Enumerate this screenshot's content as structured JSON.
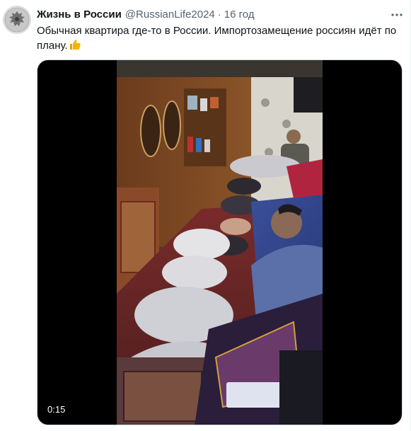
{
  "tweet": {
    "author_name": "Жизнь в России",
    "author_handle": "@RussianLife2024",
    "separator": "·",
    "time": "16 год",
    "text": "Обычная квартира где-то в России. Импортозамещение россиян идёт по плану.",
    "emoji": "👍",
    "more_icon": "more-horizontal-icon",
    "avatar_icon": "double-headed-eagle-emblem"
  },
  "video": {
    "duration": "0:15"
  },
  "colors": {
    "secondary_text": "#536471",
    "primary_text": "#0f1419",
    "media_border": "#cfd9de",
    "thumb_emoji": "#f4b400"
  }
}
